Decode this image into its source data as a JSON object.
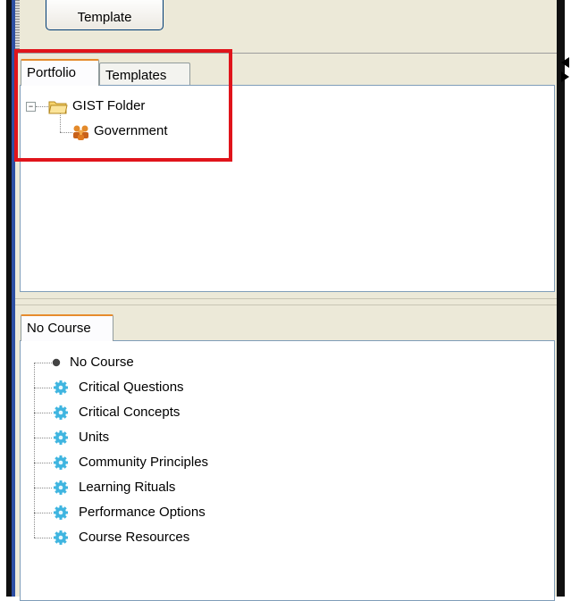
{
  "toolbar": {
    "template_button_label": "Template"
  },
  "top_panel": {
    "tabs": [
      {
        "label": "Portfolio",
        "active": true
      },
      {
        "label": "Templates",
        "active": false
      }
    ],
    "tree": {
      "folder": {
        "label": "GIST Folder",
        "expanded": true,
        "icon": "folder-icon"
      },
      "children": [
        {
          "label": "Government",
          "icon": "people-group-icon"
        }
      ]
    }
  },
  "bottom_panel": {
    "tabs": [
      {
        "label": "No Course",
        "active": true
      }
    ],
    "tree": {
      "root": {
        "label": "No Course",
        "icon": "bullet-icon"
      },
      "items": [
        {
          "label": "Critical Questions",
          "icon": "gear-icon"
        },
        {
          "label": "Critical Concepts",
          "icon": "gear-icon"
        },
        {
          "label": "Units",
          "icon": "gear-icon"
        },
        {
          "label": "Community Principles",
          "icon": "gear-icon"
        },
        {
          "label": "Learning Rituals",
          "icon": "gear-icon"
        },
        {
          "label": "Performance Options",
          "icon": "gear-icon"
        },
        {
          "label": "Course Resources",
          "icon": "gear-icon"
        }
      ]
    }
  },
  "colors": {
    "highlight_border": "#e0141b",
    "active_tab_accent": "#e68b2c",
    "gear": "#3fb5e0"
  }
}
